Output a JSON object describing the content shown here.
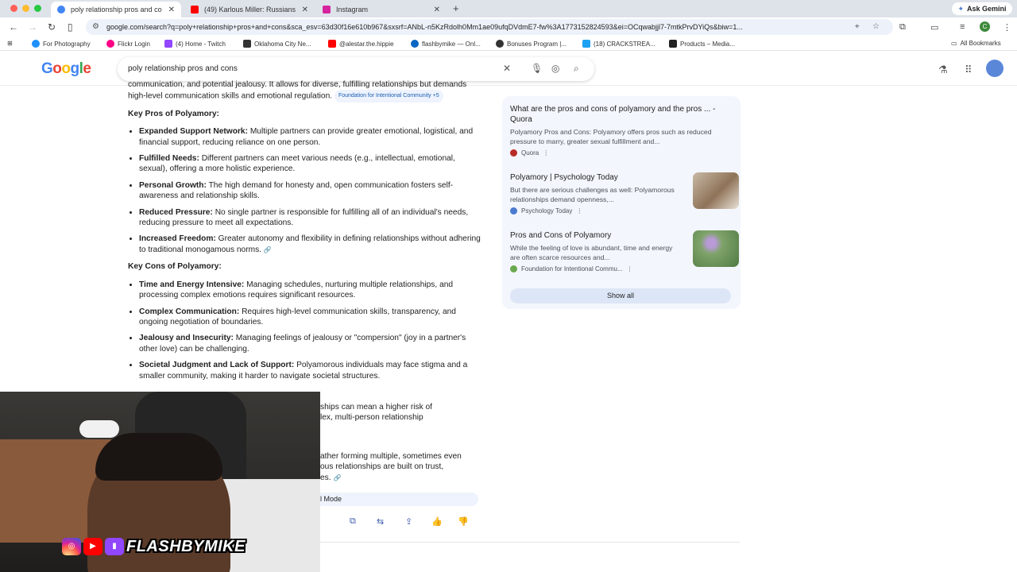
{
  "tabs": [
    {
      "title": "poly relationship pros and co",
      "favicon_color": "#4285f4",
      "active": true
    },
    {
      "title": "(49) Karlous Miller: Russians",
      "favicon_color": "#ff0000",
      "active": false
    },
    {
      "title": "Instagram",
      "favicon_color": "#d6249f",
      "active": false
    }
  ],
  "ask_gemini": "Ask Gemini",
  "url": "google.com/search?q=poly+relationship+pros+and+cons&sca_esv=63d30f16e610b967&sxsrf=ANbL-n5KzRdolh0Mm1ae09ufqDVdmE7-fw%3A1773152824593&ei=OCqwabjjl7-7mtkPrvDYiQs&biw=1...",
  "profile_letter": "C",
  "bookmarks": [
    {
      "label": "For Photography",
      "color": "#1e90ff"
    },
    {
      "label": "Flickr Login",
      "color": "#ff0084"
    },
    {
      "label": "(4) Home - Twitch",
      "color": "#9146ff"
    },
    {
      "label": "Oklahoma City Ne...",
      "color": "#333333"
    },
    {
      "label": "@alestar.the.hippie",
      "color": "#ff0000"
    },
    {
      "label": "flashbymike — Onl...",
      "color": "#0a66c2"
    },
    {
      "label": "Bonuses Program |...",
      "color": "#333333"
    },
    {
      "label": "(18) CRACKSTREA...",
      "color": "#1da1f2"
    },
    {
      "label": "Products – Media...",
      "color": "#222222"
    }
  ],
  "all_bookmarks": "All Bookmarks",
  "google": {
    "logo": "Google",
    "query": "poly relationship pros and cons"
  },
  "overview": {
    "intro": "communication, and potential jealousy. It allows for diverse, fulfilling relationships but demands high-level communication skills and emotional regulation.",
    "intro_source": "Foundation for Intentional Community +5",
    "pros_heading": "Key Pros of Polyamory:",
    "pros": [
      {
        "term": "Expanded Support Network:",
        "text": " Multiple partners can provide greater emotional, logistical, and financial support, reducing reliance on one person."
      },
      {
        "term": "Fulfilled Needs:",
        "text": " Different partners can meet various needs (e.g., intellectual, emotional, sexual), offering a more holistic experience."
      },
      {
        "term": "Personal Growth:",
        "text": " The high demand for honesty and, open communication fosters self-awareness and relationship skills."
      },
      {
        "term": "Reduced Pressure:",
        "text": " No single partner is responsible for fulfilling all of an individual's needs, reducing pressure to meet all expectations."
      },
      {
        "term": "Increased Freedom:",
        "text": " Greater autonomy and flexibility in defining relationships without adhering to traditional monogamous norms."
      }
    ],
    "cons_heading": "Key Cons of Polyamory:",
    "cons": [
      {
        "term": "Time and Energy Intensive:",
        "text": " Managing schedules, nurturing multiple relationships, and processing complex emotions requires significant resources."
      },
      {
        "term": "Complex Communication:",
        "text": " Requires high-level communication skills, transparency, and ongoing negotiation of boundaries."
      },
      {
        "term": "Jealousy and Insecurity:",
        "text": " Managing feelings of jealousy or \"compersion\" (joy in a partner's other love) can be challenging."
      },
      {
        "term": "Societal Judgment and Lack of Support:",
        "text": " Polyamorous individuals may face stigma and a smaller community, making it harder to navigate societal structures."
      }
    ],
    "partial_line_1": "ships can mean a higher risk of",
    "partial_line_2": "lex, multi-person relationship",
    "partial_line_3": "ather forming multiple, sometimes even",
    "partial_line_4": "ous relationships are built on trust,",
    "partial_line_5": "es.",
    "ai_mode_label": "l Mode"
  },
  "right_panel": {
    "cards": [
      {
        "title": "What are the pros and cons of polyamory and the pros ... - Quora",
        "snippet": "Polyamory Pros and Cons: Polyamory offers pros such as reduced pressure to marry, greater sexual fulfillment and...",
        "source": "Quora",
        "source_color": "#b92b27"
      },
      {
        "title": "Polyamory | Psychology Today",
        "snippet": "But there are serious challenges as well: Polyamorous relationships demand openness,...",
        "source": "Psychology Today",
        "source_color": "#4a7bd0"
      },
      {
        "title": "Pros and Cons of Polyamory",
        "snippet": "While the feeling of love is abundant, time and energy are often scarce resources and...",
        "source": "Foundation for Intentional Commu...",
        "source_color": "#6aa84f"
      }
    ],
    "show_all": "Show all"
  },
  "webcam": {
    "brand_name": "FLASHBYMIKE"
  }
}
